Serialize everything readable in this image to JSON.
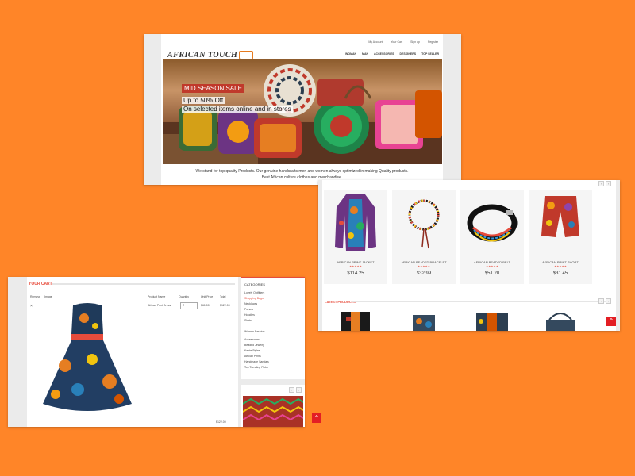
{
  "colors": {
    "background": "#FF8528",
    "accent": "#E74C3C",
    "scroll_button": "#E31E24"
  },
  "home": {
    "top_links": [
      "My Account",
      "Your Cart",
      "Sign up",
      "Register"
    ],
    "logo": "AFRICAN TOUCH",
    "nav": [
      "WOMAN",
      "MAN",
      "ACCESSORIES",
      "DESIGNERS",
      "TOP SELLER"
    ],
    "hero": {
      "tag": "MID SEASON SALE",
      "line1": "Up to 50% Off",
      "line2": "On selected items online and in stores"
    },
    "tagline1": "We stand for top quality Products. Our genuine handcrafts men and women always optimized in making Quality products.",
    "tagline2": "Best African culture clothes and merchandise."
  },
  "products": {
    "cards": [
      {
        "name": "AFRICAN PRINT JACKET",
        "rating": "★★★★★",
        "price": "$114.25"
      },
      {
        "name": "AFRICAN BEADED BRACELET",
        "rating": "★★★★★",
        "price": "$32.99"
      },
      {
        "name": "AFRICAN BEADED BELT",
        "rating": "★★★★★",
        "price": "$51.20"
      },
      {
        "name": "AFRICAN PRINT SHORT",
        "rating": "★★★★★",
        "price": "$31.45"
      }
    ],
    "section_title": "LATEST PRODUCTS",
    "icons": {
      "prev": "chevron-left-icon",
      "next": "chevron-right-icon",
      "top": "chevron-up-icon"
    }
  },
  "cart": {
    "title": "YOUR CART",
    "columns": [
      "Remove",
      "Image",
      "Product Name",
      "Quantity",
      "Unit Price",
      "Total"
    ],
    "row": {
      "product": "African Print Dress",
      "quantity": "2",
      "unit_price": "$61.00",
      "total": "$122.00"
    },
    "grand_total": "$122.00",
    "sidebar": {
      "title": "CATEGORIES",
      "items": [
        "Lovely Outfitters",
        "Shopping Bags",
        "Necklaces",
        "Purses",
        "Hoodies",
        "Shirts",
        "Women Fashion",
        "Accessories",
        "Beaded Jewelry",
        "Kente Styles",
        "African Prints",
        "Handmade Sandals",
        "Top Trending Picks"
      ]
    }
  }
}
